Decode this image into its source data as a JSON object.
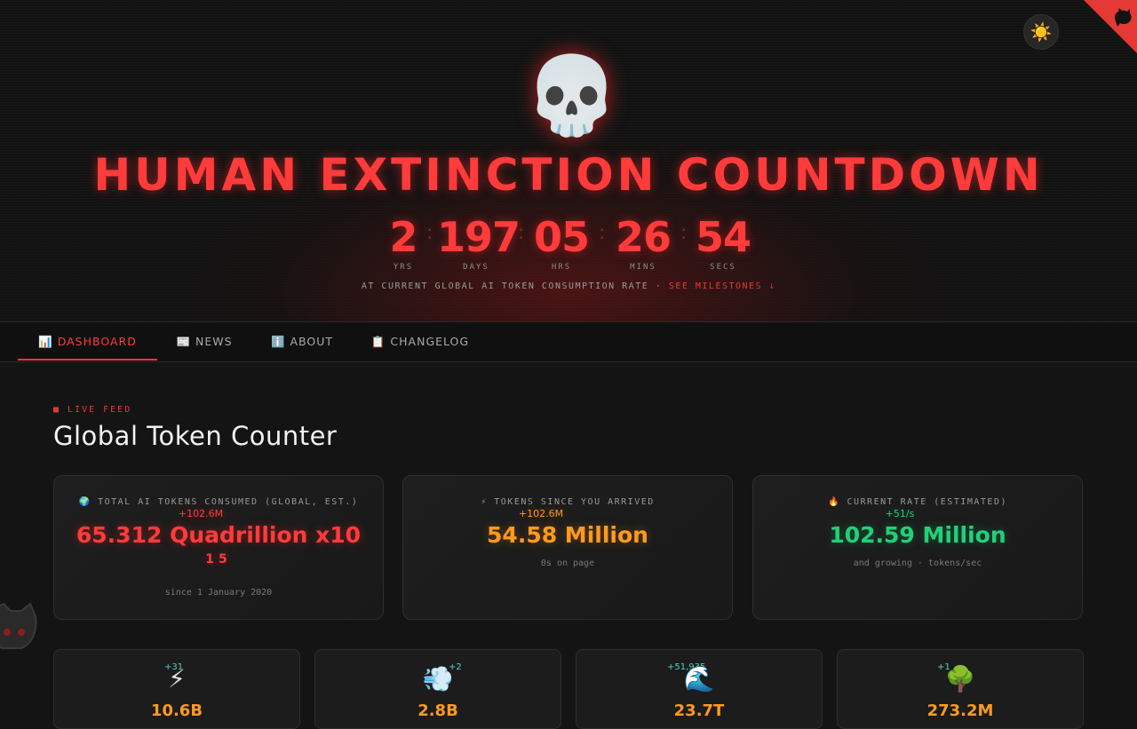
{
  "header": {
    "theme_icon": "☀️",
    "skull": "💀",
    "title": "HUMAN EXTINCTION COUNTDOWN",
    "countdown": [
      {
        "value": "2",
        "label": "YRS"
      },
      {
        "value": "197",
        "label": "DAYS"
      },
      {
        "value": "05",
        "label": "HRS"
      },
      {
        "value": "26",
        "label": "MINS"
      },
      {
        "value": "54",
        "label": "SECS"
      }
    ],
    "separator": ":",
    "rate_text": "AT CURRENT GLOBAL AI TOKEN CONSUMPTION RATE · ",
    "milestones_link": "SEE MILESTONES ↓"
  },
  "tabs": [
    {
      "label": "📊 DASHBOARD",
      "active": true
    },
    {
      "label": "📰 NEWS",
      "active": false
    },
    {
      "label": "ℹ️ ABOUT",
      "active": false
    },
    {
      "label": "📋 CHANGELOG",
      "active": false
    }
  ],
  "section": {
    "live_label": "■ LIVE FEED",
    "title": "Global Token Counter"
  },
  "cards": [
    {
      "label": "🌍 TOTAL AI TOKENS CONSUMED (GLOBAL, EST.)",
      "delta": "+102.6M",
      "value": "65.312 Quadrillion x10",
      "value_cont": "15",
      "sub": "since 1 January 2020",
      "color": "#ff3b3b"
    },
    {
      "label": "⚡ TOKENS SINCE YOU ARRIVED",
      "delta": "+102.6M",
      "value": "54.58 Million",
      "sub": "0s on page",
      "color": "#ff9a1f"
    },
    {
      "label": "🔥 CURRENT RATE (ESTIMATED)",
      "delta": "+51/s",
      "value": "102.59 Million",
      "sub": "and growing · tokens/sec",
      "color": "#22d07a"
    }
  ],
  "mini_cards": [
    {
      "icon": "⚡",
      "delta": "+31",
      "value": "10.6B"
    },
    {
      "icon": "💨",
      "delta": "+2",
      "value": "2.8B"
    },
    {
      "icon": "🌊",
      "delta": "+51,935",
      "value": "23.7T"
    },
    {
      "icon": "🌳",
      "delta": "+1",
      "value": "273.2M"
    }
  ],
  "colors": {
    "accent": "#e53935",
    "red": "#ff3b3b",
    "orange": "#ff9a1f",
    "green": "#22d07a",
    "bg": "#141414"
  }
}
